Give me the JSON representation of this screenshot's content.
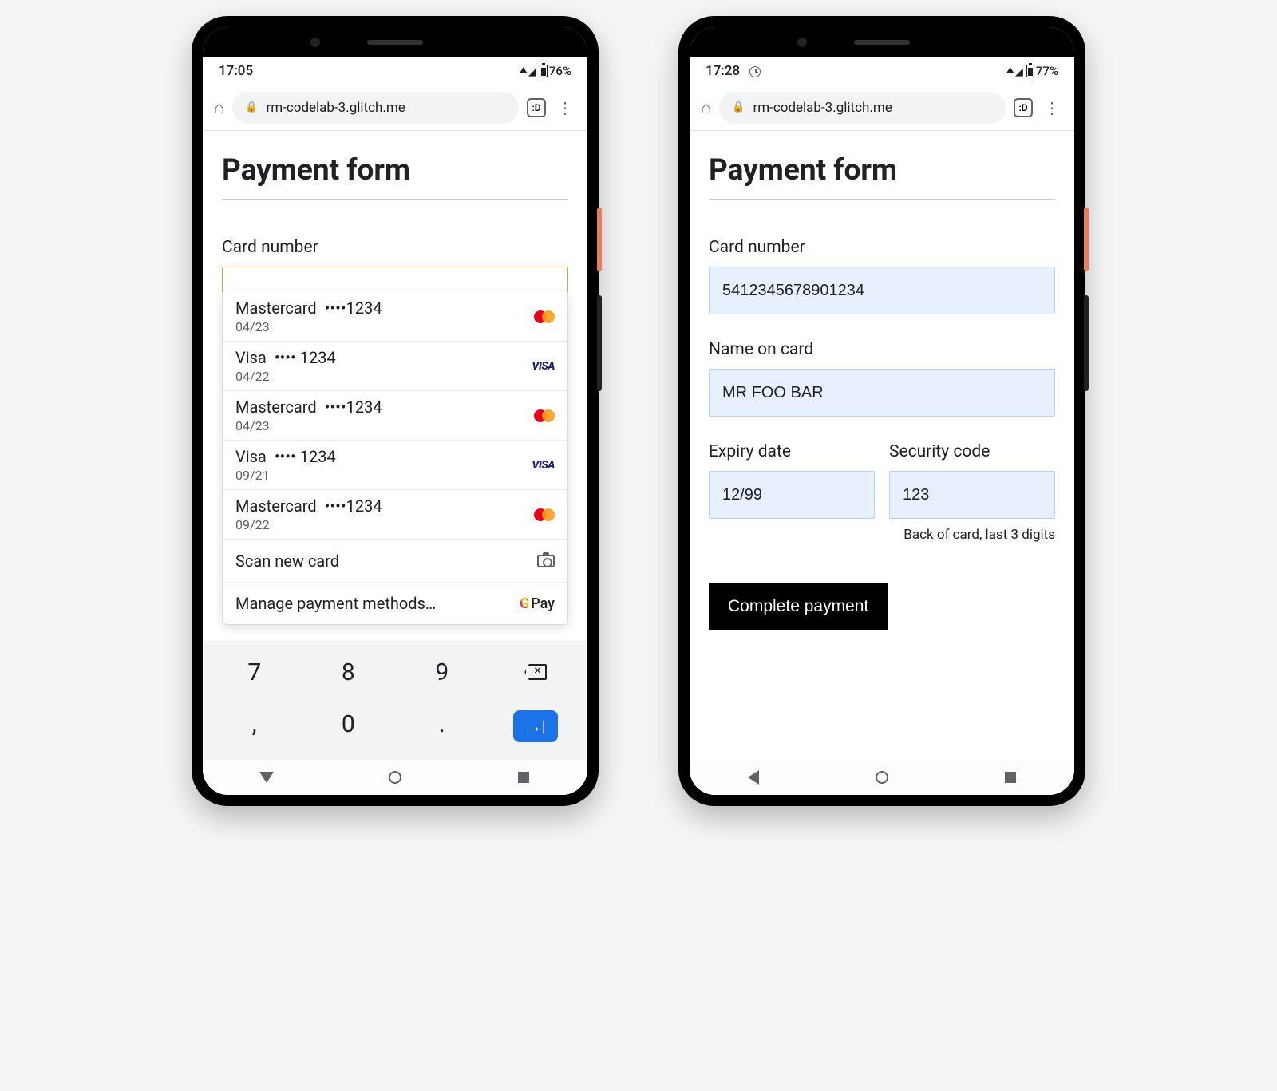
{
  "phone1": {
    "status": {
      "time": "17:05",
      "battery": "76%"
    },
    "url": "rm-codelab-3.glitch.me",
    "tab_badge": ":D",
    "page": {
      "title": "Payment form",
      "card_number_label": "Card number"
    },
    "autofill": {
      "cards": [
        {
          "brand": "Mastercard",
          "masked": "••••1234",
          "exp": "04/23",
          "logo": "mc"
        },
        {
          "brand": "Visa",
          "masked": "•••• 1234",
          "exp": "04/22",
          "logo": "visa"
        },
        {
          "brand": "Mastercard",
          "masked": "••••1234",
          "exp": "04/23",
          "logo": "mc"
        },
        {
          "brand": "Visa",
          "masked": "•••• 1234",
          "exp": "09/21",
          "logo": "visa"
        },
        {
          "brand": "Mastercard",
          "masked": "••••1234",
          "exp": "09/22",
          "logo": "mc"
        }
      ],
      "scan_label": "Scan new card",
      "manage_label": "Manage payment methods…",
      "gpay_label": "Pay"
    },
    "keyboard": {
      "row1": [
        "7",
        "8",
        "9"
      ],
      "row2": [
        ",",
        "0",
        "."
      ]
    }
  },
  "phone2": {
    "status": {
      "time": "17:28",
      "battery": "77%"
    },
    "url": "rm-codelab-3.glitch.me",
    "tab_badge": ":D",
    "page": {
      "title": "Payment form",
      "card_number_label": "Card number",
      "card_number_value": "5412345678901234",
      "name_label": "Name on card",
      "name_value": "MR FOO BAR",
      "expiry_label": "Expiry date",
      "expiry_value": "12/99",
      "cvv_label": "Security code",
      "cvv_value": "123",
      "cvv_help": "Back of card, last 3 digits",
      "submit_label": "Complete payment"
    }
  }
}
